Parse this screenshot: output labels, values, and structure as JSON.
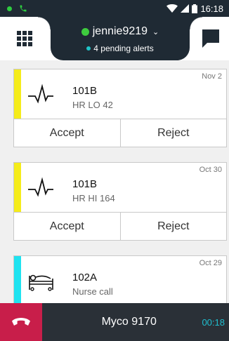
{
  "statusbar": {
    "time": "16:18"
  },
  "header": {
    "username": "jennie9219",
    "chevron": "⌄",
    "alerts": "4 pending alerts"
  },
  "alerts": [
    {
      "code": "101B",
      "detail": "HR LO 42",
      "date": "Nov 2",
      "color": "#f5ec1a",
      "icon": "heartbeat-icon",
      "accept": "Accept",
      "reject": "Reject"
    },
    {
      "code": "101B",
      "detail": "HR HI 164",
      "date": "Oct 30",
      "color": "#f5ec1a",
      "icon": "heartbeat-icon",
      "accept": "Accept",
      "reject": "Reject"
    },
    {
      "code": "102A",
      "detail": "Nurse call",
      "date": "Oct 29",
      "color": "#1fe3f0",
      "icon": "patient-bed-icon"
    }
  ],
  "call": {
    "name": "Myco 9170",
    "duration": "00:18",
    "hangup_color": "#c81e4a"
  }
}
